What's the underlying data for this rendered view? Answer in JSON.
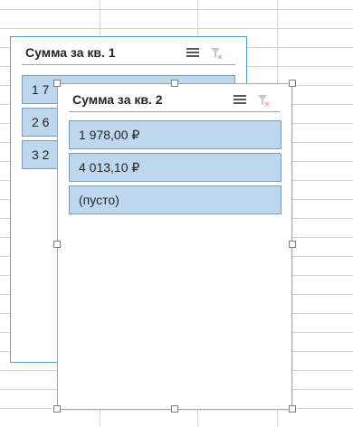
{
  "slicer_back": {
    "title": "Сумма за кв. 1",
    "items": [
      "1 7",
      "2 6",
      "3 2"
    ]
  },
  "slicer_front": {
    "title": "Сумма за кв. 2",
    "items": [
      "1 978,00 ₽",
      "4 013,10 ₽",
      "(пусто)"
    ]
  },
  "colors": {
    "item_fill": "#bdd7ee",
    "item_border": "#7f9db9",
    "accent_border": "#5b9bd5",
    "gridline": "#d4d4d4"
  },
  "icons": [
    "multi-select-icon",
    "clear-filter-icon"
  ]
}
